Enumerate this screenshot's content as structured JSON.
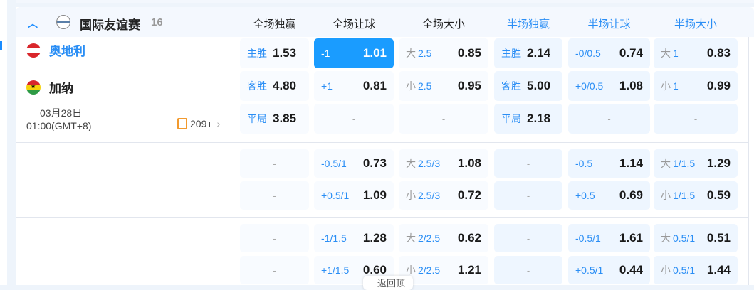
{
  "league": {
    "name": "国际友谊赛",
    "count": "16"
  },
  "columns": [
    "全场独赢",
    "全场让球",
    "全场大小",
    "半场独赢",
    "半场让球",
    "半场大小"
  ],
  "match": {
    "home": "奥地利",
    "away": "加纳",
    "date": "03月28日",
    "time": "01:00(GMT+8)",
    "more_count": "209+"
  },
  "groups": [
    {
      "rows": [
        [
          {
            "lab": "主胜",
            "val": "1.53"
          },
          {
            "lab": "-1",
            "val": "1.01",
            "selected": true
          },
          {
            "pre": "大",
            "lab": "2.5",
            "val": "0.85"
          },
          {
            "lab": "主胜",
            "val": "2.14"
          },
          {
            "lab": "-0/0.5",
            "val": "0.74"
          },
          {
            "pre": "大",
            "lab": "1",
            "val": "0.83"
          }
        ],
        [
          {
            "lab": "客胜",
            "val": "4.80"
          },
          {
            "lab": "+1",
            "val": "0.81"
          },
          {
            "pre": "小",
            "lab": "2.5",
            "val": "0.95"
          },
          {
            "lab": "客胜",
            "val": "5.00"
          },
          {
            "lab": "+0/0.5",
            "val": "1.08"
          },
          {
            "pre": "小",
            "lab": "1",
            "val": "0.99"
          }
        ],
        [
          {
            "lab": "平局",
            "val": "3.85"
          },
          {
            "empty": "-"
          },
          {
            "empty": "-"
          },
          {
            "lab": "平局",
            "val": "2.18"
          },
          {
            "empty": "-"
          },
          {
            "empty": "-"
          }
        ]
      ]
    },
    {
      "rows": [
        [
          {
            "empty": "-"
          },
          {
            "lab": "-0.5/1",
            "val": "0.73"
          },
          {
            "pre": "大",
            "lab": "2.5/3",
            "val": "1.08"
          },
          {
            "empty": "-"
          },
          {
            "lab": "-0.5",
            "val": "1.14"
          },
          {
            "pre": "大",
            "lab": "1/1.5",
            "val": "1.29"
          }
        ],
        [
          {
            "empty": "-"
          },
          {
            "lab": "+0.5/1",
            "val": "1.09"
          },
          {
            "pre": "小",
            "lab": "2.5/3",
            "val": "0.72"
          },
          {
            "empty": "-"
          },
          {
            "lab": "+0.5",
            "val": "0.69"
          },
          {
            "pre": "小",
            "lab": "1/1.5",
            "val": "0.59"
          }
        ]
      ]
    },
    {
      "rows": [
        [
          {
            "empty": "-"
          },
          {
            "lab": "-1/1.5",
            "val": "1.28"
          },
          {
            "pre": "大",
            "lab": "2/2.5",
            "val": "0.62"
          },
          {
            "empty": "-"
          },
          {
            "lab": "-0.5/1",
            "val": "1.61"
          },
          {
            "pre": "大",
            "lab": "0.5/1",
            "val": "0.51"
          }
        ],
        [
          {
            "empty": "-"
          },
          {
            "lab": "+1/1.5",
            "val": "0.60"
          },
          {
            "pre": "小",
            "lab": "2/2.5",
            "val": "1.21"
          },
          {
            "empty": "-"
          },
          {
            "lab": "+0.5/1",
            "val": "0.44"
          },
          {
            "pre": "小",
            "lab": "0.5/1",
            "val": "1.44"
          }
        ]
      ]
    }
  ],
  "back_to_top": "返回顶部",
  "colors": {
    "accent": "#1a9cff",
    "label_blue": "#2a8ef5",
    "half_bg": "#eef6ff"
  }
}
